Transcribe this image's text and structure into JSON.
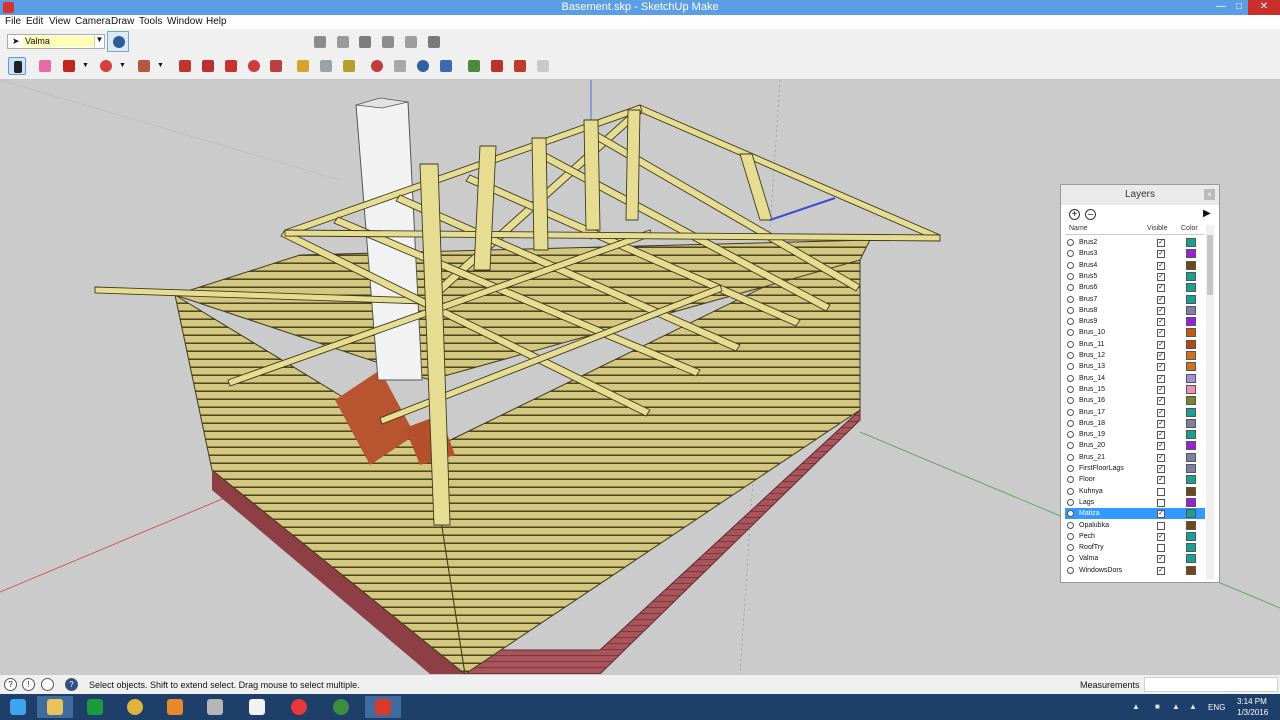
{
  "window": {
    "title": "Basement.skp - SketchUp Make"
  },
  "menu": [
    "File",
    "Edit",
    "View",
    "Camera",
    "Draw",
    "Tools",
    "Window",
    "Help"
  ],
  "layer_toolbar": {
    "current_layer": "Valma"
  },
  "layers_panel": {
    "title": "Layers",
    "columns": {
      "name": "Name",
      "visible": "Visible",
      "color": "Color"
    },
    "layers": [
      {
        "name": "Brus2",
        "visible": true,
        "color": "#1a9f95"
      },
      {
        "name": "Brus3",
        "visible": true,
        "color": "#9b1fd8"
      },
      {
        "name": "Brus4",
        "visible": true,
        "color": "#6e4a12"
      },
      {
        "name": "Brus5",
        "visible": true,
        "color": "#1a9f95"
      },
      {
        "name": "Brus6",
        "visible": true,
        "color": "#1a9f95"
      },
      {
        "name": "Brus7",
        "visible": true,
        "color": "#1a9f95"
      },
      {
        "name": "Brus8",
        "visible": true,
        "color": "#7f7fa3"
      },
      {
        "name": "Brus9",
        "visible": true,
        "color": "#9b1fd8"
      },
      {
        "name": "Brus_10",
        "visible": true,
        "color": "#c65a0c"
      },
      {
        "name": "Brus_11",
        "visible": true,
        "color": "#b34a0c"
      },
      {
        "name": "Brus_12",
        "visible": true,
        "color": "#d0711d"
      },
      {
        "name": "Brus_13",
        "visible": true,
        "color": "#d0711d"
      },
      {
        "name": "Brus_14",
        "visible": true,
        "color": "#a093d6"
      },
      {
        "name": "Brus_15",
        "visible": true,
        "color": "#f28fb0"
      },
      {
        "name": "Brus_16",
        "visible": true,
        "color": "#7d8224"
      },
      {
        "name": "Brus_17",
        "visible": true,
        "color": "#1a9f95"
      },
      {
        "name": "Brus_18",
        "visible": true,
        "color": "#7f7fa3"
      },
      {
        "name": "Brus_19",
        "visible": true,
        "color": "#1a9f95"
      },
      {
        "name": "Brus_20",
        "visible": true,
        "color": "#9b1fd8"
      },
      {
        "name": "Brus_21",
        "visible": true,
        "color": "#7f7fa3"
      },
      {
        "name": "FirstFloorLags",
        "visible": true,
        "color": "#7f7fa3"
      },
      {
        "name": "Floor",
        "visible": true,
        "color": "#1a9f95"
      },
      {
        "name": "Kuhnya",
        "visible": false,
        "color": "#6e4a12"
      },
      {
        "name": "Lags",
        "visible": false,
        "color": "#9b1fd8"
      },
      {
        "name": "Matiza",
        "visible": true,
        "color": "#1a9f95",
        "selected": true
      },
      {
        "name": "Opalubka",
        "visible": false,
        "color": "#6e4a12"
      },
      {
        "name": "Pech",
        "visible": true,
        "color": "#1a9f95"
      },
      {
        "name": "RoofTry",
        "visible": false,
        "color": "#1a9f95"
      },
      {
        "name": "Valma",
        "visible": true,
        "color": "#1a9f95"
      },
      {
        "name": "WindowsDors",
        "visible": true,
        "color": "#6e4a12"
      }
    ]
  },
  "status": {
    "hint": "Select objects. Shift to extend select. Drag mouse to select multiple.",
    "measurements_label": "Measurements"
  },
  "taskbar": {
    "language": "ENG",
    "time": "3:14 PM",
    "date": "1/3/2016"
  }
}
